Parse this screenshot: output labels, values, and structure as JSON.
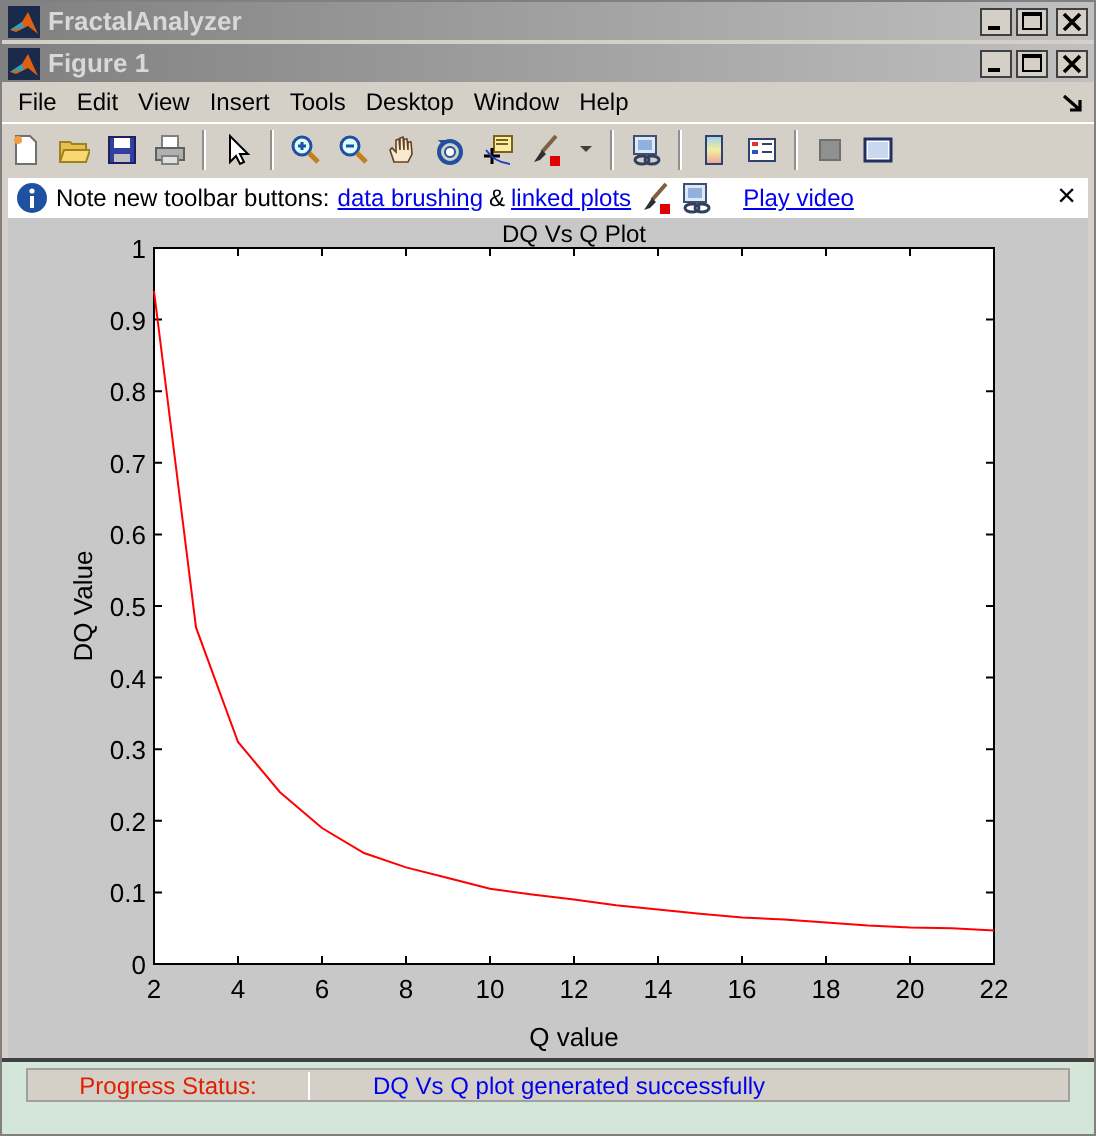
{
  "app_window": {
    "title": "FractalAnalyzer"
  },
  "figure_window": {
    "title": "Figure 1"
  },
  "menu": [
    "File",
    "Edit",
    "View",
    "Insert",
    "Tools",
    "Desktop",
    "Window",
    "Help"
  ],
  "info_bar": {
    "text": "Note new toolbar buttons:",
    "links": [
      {
        "label": "data brushing"
      },
      {
        "label": "linked plots"
      }
    ],
    "joiner": "&",
    "video_link": "Play video",
    "close": "×"
  },
  "plot": {
    "chart_data": {
      "type": "line",
      "title": "DQ Vs Q Plot",
      "xlabel": "Q value",
      "ylabel": "DQ Value",
      "xlim": [
        2,
        22
      ],
      "ylim": [
        0,
        1
      ],
      "xticks": [
        2,
        4,
        6,
        8,
        10,
        12,
        14,
        16,
        18,
        20,
        22
      ],
      "yticks": [
        0,
        0.1,
        0.2,
        0.3,
        0.4,
        0.5,
        0.6,
        0.7,
        0.8,
        0.9,
        1
      ],
      "x": [
        2,
        3,
        4,
        5,
        6,
        7,
        8,
        9,
        10,
        11,
        12,
        13,
        14,
        15,
        16,
        17,
        18,
        19,
        20,
        21,
        22
      ],
      "series": [
        {
          "color": "#ff0000",
          "values": [
            0.94,
            0.47,
            0.31,
            0.24,
            0.19,
            0.155,
            0.135,
            0.12,
            0.105,
            0.097,
            0.09,
            0.082,
            0.076,
            0.07,
            0.065,
            0.062,
            0.058,
            0.054,
            0.051,
            0.05,
            0.047
          ]
        }
      ]
    }
  },
  "status": {
    "label": "Progress Status:",
    "message": "DQ Vs Q plot generated successfully"
  }
}
